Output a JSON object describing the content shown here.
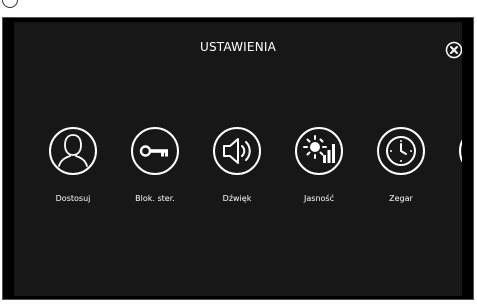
{
  "header": {
    "title": "USTAWIENIA"
  },
  "settings_items": [
    {
      "label": "Dostosuj",
      "icon": "person-icon"
    },
    {
      "label": "Blok. ster.",
      "icon": "key-icon"
    },
    {
      "label": "Dźwięk",
      "icon": "speaker-icon"
    },
    {
      "label": "Jasność",
      "icon": "brightness-icon"
    },
    {
      "label": "Zegar",
      "icon": "clock-icon"
    }
  ],
  "colors": {
    "background": "#171717",
    "foreground": "#ffffff"
  }
}
